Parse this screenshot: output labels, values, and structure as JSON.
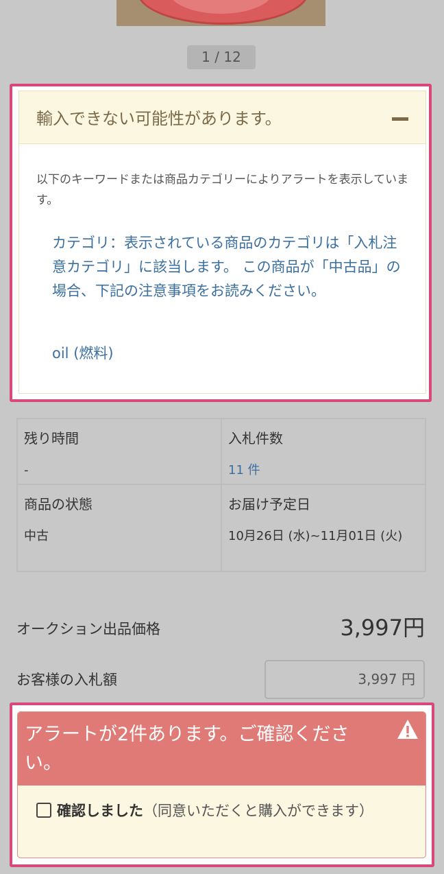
{
  "gallery": {
    "pager": "1 / 12"
  },
  "import_alert": {
    "title": "輸入できない可能性があります。",
    "description": "以下のキーワードまたは商品カテゴリーによりアラートを表示しています。",
    "category_note": "カテゴリ：表示されている商品のカテゴリは「入札注意カテゴリ」に該当します。 この商品が「中古品」の場合、下記の注意事項をお読みください。",
    "keyword": "oil (燃料)"
  },
  "info": {
    "remaining_label": "残り時間",
    "remaining_value": "-",
    "bids_label": "入札件数",
    "bids_value": "11 件",
    "condition_label": "商品の状態",
    "condition_value": "中古",
    "delivery_label": "お届け予定日",
    "delivery_value": "10月26日 (水)~11月01日 (火)"
  },
  "pricing": {
    "auction_price_label": "オークション出品価格",
    "auction_price_value": "3,997円",
    "bid_amount_label": "お客様の入札額",
    "bid_amount_value": "3,997 円"
  },
  "confirm": {
    "title": "アラートが2件あります。ご確認ください。",
    "checkbox_label": "確認しました",
    "checkbox_note": "（同意いただくと購入ができます）"
  },
  "colors": {
    "highlight": "#d9487a",
    "alert_bg": "#fcf7e1",
    "link": "#3b6fa0",
    "confirm_header": "#e07a76"
  },
  "icons": [
    "minus-icon",
    "warning-icon",
    "checkbox-icon"
  ]
}
